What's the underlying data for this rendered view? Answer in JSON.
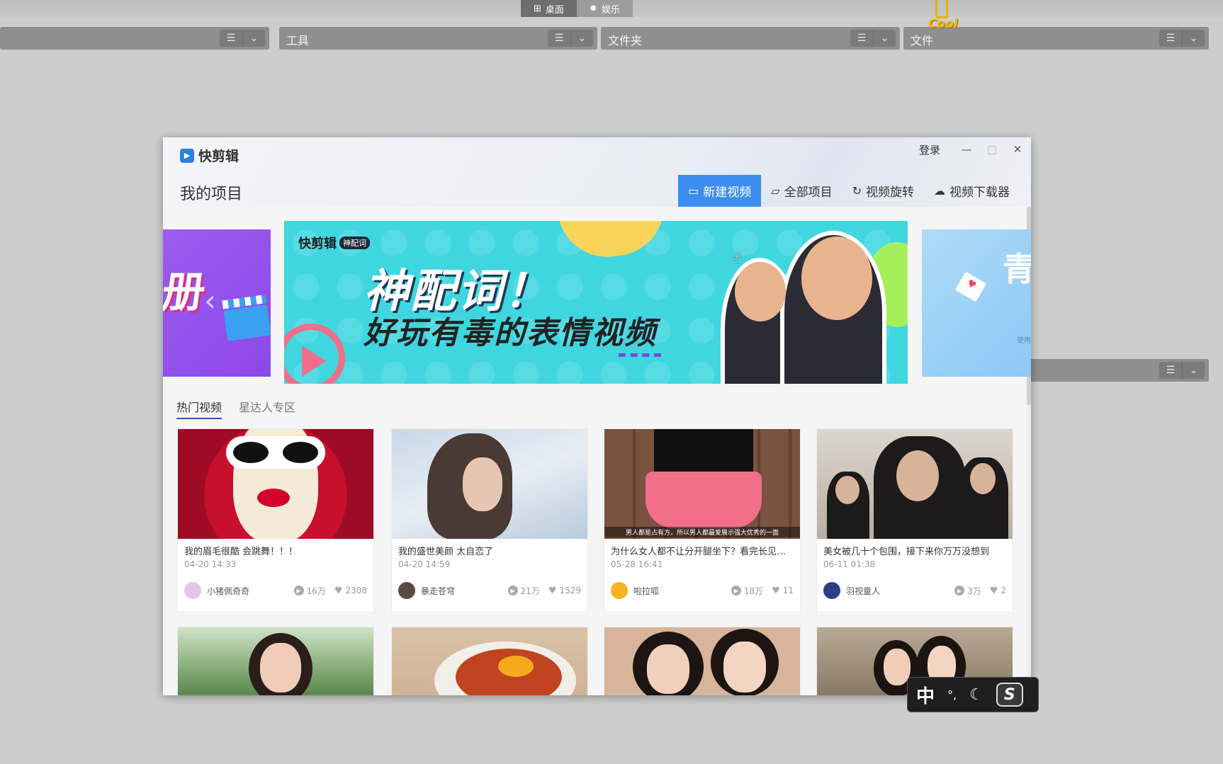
{
  "desktop": {
    "tabs": [
      {
        "label": "桌面",
        "icon": "windows-icon"
      },
      {
        "label": "娱乐",
        "icon": "star-icon"
      }
    ],
    "fences": [
      {
        "title": ""
      },
      {
        "title": "工具"
      },
      {
        "title": "文件夹"
      },
      {
        "title": "文件"
      },
      {
        "title": ""
      }
    ],
    "badge": "Cool"
  },
  "app": {
    "brand": "快剪辑",
    "login": "登录",
    "page_title": "我的项目",
    "toolbar": {
      "new_video": "新建视频",
      "all_projects": "全部项目",
      "rotate": "视频旋转",
      "downloader": "视频下载器"
    },
    "banner": {
      "left_text": "册",
      "brand": "快剪辑",
      "tag": "神配词",
      "title": "神配词！",
      "subtitle": "好玩有毒的表情视频",
      "right_text": "青",
      "right_small": "使用"
    },
    "content_tabs": [
      "热门视频",
      "星达人专区"
    ],
    "videos": [
      {
        "title": "我的眉毛很酷 会跳舞！！！",
        "date": "04-20 14:33",
        "author": "小猪佩奇奇",
        "plays": "16万",
        "likes": "2308",
        "avatar_color": "#e5c6e8",
        "caption": ""
      },
      {
        "title": "我的盛世美颜 太自恋了",
        "date": "04-20 14:59",
        "author": "暴走苍穹",
        "plays": "21万",
        "likes": "1529",
        "avatar_color": "#5a4a42",
        "caption": ""
      },
      {
        "title": "为什么女人都不让分开腿坐下？看完长见…",
        "date": "05-28 16:41",
        "author": "啦拉呱",
        "plays": "18万",
        "likes": "11",
        "avatar_color": "#f5b323",
        "caption": "男人都是占有方，所以男人都最爱展示强大优秀的一面"
      },
      {
        "title": "美女被几十个包围，接下来你万万没想到",
        "date": "06-11 01:38",
        "author": "羽视童人",
        "plays": "3万",
        "likes": "2",
        "avatar_color": "#2a3f8a",
        "caption": ""
      }
    ]
  },
  "ime": {
    "mode": "中",
    "punc": "°,",
    "logo": "S"
  }
}
